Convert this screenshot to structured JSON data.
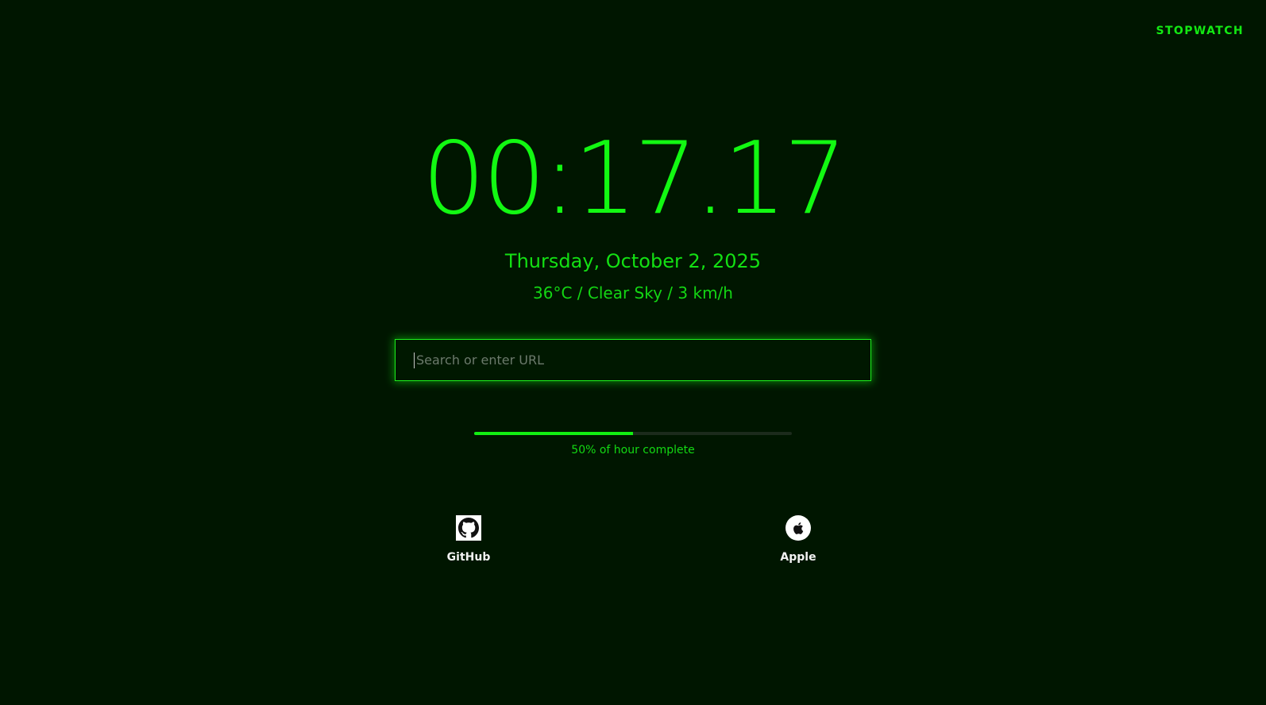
{
  "header": {
    "mode_link": "STOPWATCH"
  },
  "clock": {
    "time": "00:17.17"
  },
  "info": {
    "date": "Thursday, October 2, 2025",
    "weather": "36°C / Clear Sky / 3 km/h"
  },
  "search": {
    "placeholder": "Search or enter URL",
    "value": ""
  },
  "progress": {
    "percent": 50,
    "label": "50% of hour complete"
  },
  "shortcuts": [
    {
      "label": "GitHub",
      "icon": "github-icon"
    },
    {
      "label": "Apple",
      "icon": "apple-icon"
    }
  ],
  "colors": {
    "background": "#001600",
    "accent": "#12f812",
    "link_text": "#f2f2f2"
  }
}
